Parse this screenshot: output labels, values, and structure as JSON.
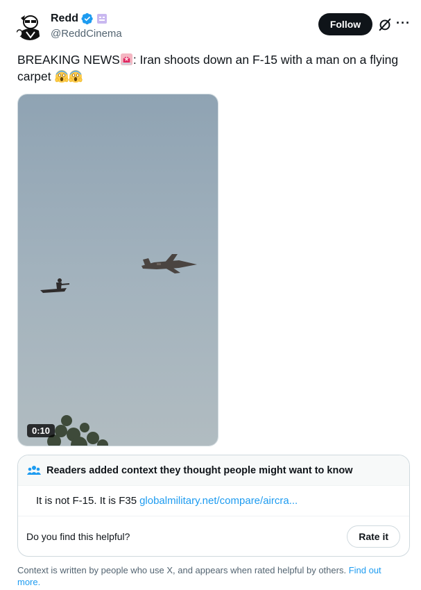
{
  "author": {
    "name": "Redd",
    "handle": "@ReddCinema"
  },
  "actions": {
    "follow_label": "Follow",
    "grok_icon": "grok-slash-icon",
    "more_icon": "more-horizontal-icon",
    "more_label": "···"
  },
  "tweet": {
    "text_before": "BREAKING NEWS",
    "text_after": ": Iran shoots down an F-15 with a man on a flying carpet",
    "emojis": [
      "police-siren-emoji",
      "screaming-face-emoji",
      "screaming-face-emoji"
    ]
  },
  "media": {
    "duration": "0:10"
  },
  "community_note": {
    "header": "Readers added context they thought people might want to know",
    "body": "It is not F-15. It is F35",
    "link": "globalmilitary.net/compare/aircra...",
    "question": "Do you find this helpful?",
    "rate_label": "Rate it"
  },
  "footer": {
    "text": "Context is written by people who use X, and appears when rated helpful by others.",
    "link": "Find out more."
  },
  "colors": {
    "accent": "#1d9bf0",
    "text": "#0f1419",
    "secondary": "#536471",
    "verified": "#1d9bf0",
    "sky": "#9fb0bd"
  }
}
